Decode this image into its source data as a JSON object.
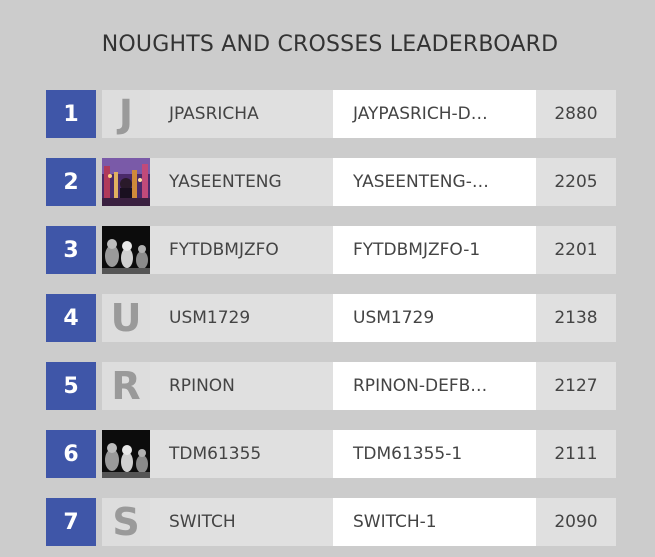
{
  "title": "NOUGHTS AND CROSSES LEADERBOARD",
  "rows": [
    {
      "rank": "1",
      "avatar": {
        "type": "letter",
        "letter": "J"
      },
      "name": "JPASRICHA",
      "bot": "JAYPASRICH-D…",
      "score": "2880"
    },
    {
      "rank": "2",
      "avatar": {
        "type": "photo",
        "icon": "city-night-photo"
      },
      "name": "YASEENTENG",
      "bot": "YASEENTENG-…",
      "score": "2205"
    },
    {
      "rank": "3",
      "avatar": {
        "type": "photo",
        "icon": "chess-pieces-photo"
      },
      "name": "FYTDBMJZFO",
      "bot": "FYTDBMJZFO-1",
      "score": "2201"
    },
    {
      "rank": "4",
      "avatar": {
        "type": "letter",
        "letter": "U"
      },
      "name": "USM1729",
      "bot": "USM1729",
      "score": "2138"
    },
    {
      "rank": "5",
      "avatar": {
        "type": "letter",
        "letter": "R"
      },
      "name": "RPINON",
      "bot": "RPINON-DEFB…",
      "score": "2127"
    },
    {
      "rank": "6",
      "avatar": {
        "type": "photo",
        "icon": "chess-pieces-photo"
      },
      "name": "TDM61355",
      "bot": "TDM61355-1",
      "score": "2111"
    },
    {
      "rank": "7",
      "avatar": {
        "type": "letter",
        "letter": "S"
      },
      "name": "SWITCH",
      "bot": "SWITCH-1",
      "score": "2090"
    }
  ],
  "colors": {
    "background": "#cccccc",
    "rank_badge": "#3f56a8",
    "cell_grey": "#e0e0e0",
    "cell_white": "#ffffff",
    "letter_avatar": "#9a9a9a"
  }
}
